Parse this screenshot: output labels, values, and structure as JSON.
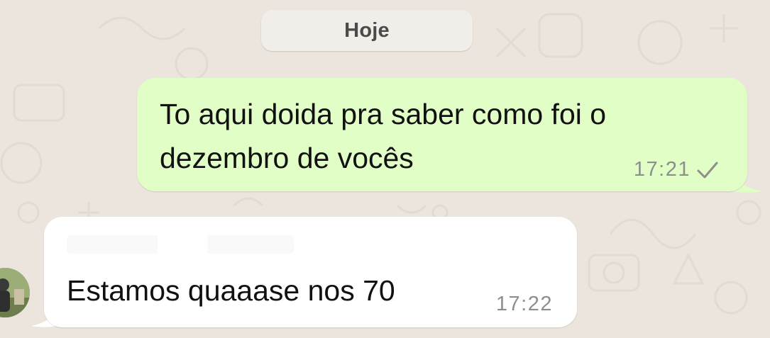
{
  "chat": {
    "date_divider": "Hoje",
    "messages": [
      {
        "direction": "outgoing",
        "text": "To aqui doida pra saber como foi o dezembro de vocês",
        "time": "17:21",
        "status_icon": "single-check-icon"
      },
      {
        "direction": "incoming",
        "text": "Estamos quaaase nos 70",
        "time": "17:22"
      }
    ]
  },
  "colors": {
    "wallpaper": "#ece5dd",
    "outgoing_bubble": "#e1fec6",
    "incoming_bubble": "#ffffff",
    "timestamp": "#8c8f8a"
  }
}
